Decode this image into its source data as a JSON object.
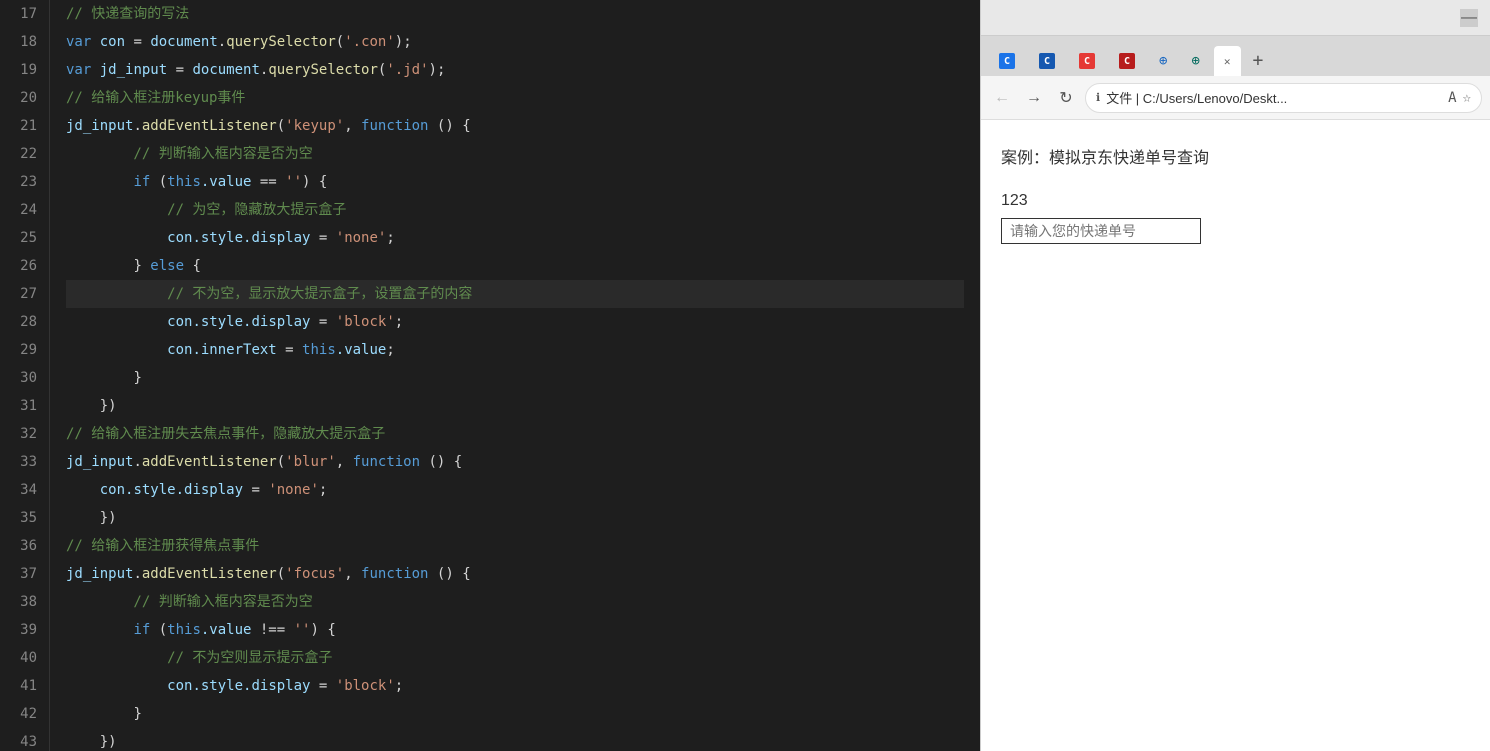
{
  "editor": {
    "lines": [
      {
        "num": 17,
        "tokens": [
          {
            "t": "comment",
            "c": "comment",
            "v": "// 快递查询的写法"
          }
        ]
      },
      {
        "num": 18,
        "tokens": [
          {
            "t": "kw",
            "c": "kw",
            "v": "var"
          },
          {
            "t": "sp",
            "c": "punc",
            "v": " "
          },
          {
            "t": "varname",
            "c": "varname",
            "v": "con"
          },
          {
            "t": "op",
            "c": "op",
            "v": " = "
          },
          {
            "t": "obj",
            "c": "varname",
            "v": "document"
          },
          {
            "t": "dot",
            "c": "punc",
            "v": "."
          },
          {
            "t": "fn",
            "c": "method",
            "v": "querySelector"
          },
          {
            "t": "p1",
            "c": "punc",
            "v": "("
          },
          {
            "t": "str",
            "c": "str",
            "v": "'.con'"
          },
          {
            "t": "p2",
            "c": "punc",
            "v": ");"
          }
        ]
      },
      {
        "num": 19,
        "tokens": [
          {
            "t": "kw",
            "c": "kw",
            "v": "var"
          },
          {
            "t": "sp",
            "c": "punc",
            "v": " "
          },
          {
            "t": "varname",
            "c": "varname",
            "v": "jd_input"
          },
          {
            "t": "op",
            "c": "op",
            "v": " = "
          },
          {
            "t": "obj",
            "c": "varname",
            "v": "document"
          },
          {
            "t": "dot",
            "c": "punc",
            "v": "."
          },
          {
            "t": "fn",
            "c": "method",
            "v": "querySelector"
          },
          {
            "t": "p1",
            "c": "punc",
            "v": "("
          },
          {
            "t": "str",
            "c": "str",
            "v": "'.jd'"
          },
          {
            "t": "p2",
            "c": "punc",
            "v": ");"
          }
        ]
      },
      {
        "num": 20,
        "tokens": [
          {
            "t": "comment",
            "c": "comment",
            "v": "// 给输入框注册keyup事件"
          }
        ]
      },
      {
        "num": 21,
        "tokens": [
          {
            "t": "varname",
            "c": "varname",
            "v": "jd_input"
          },
          {
            "t": "dot",
            "c": "punc",
            "v": "."
          },
          {
            "t": "fn",
            "c": "method",
            "v": "addEventListener"
          },
          {
            "t": "p1",
            "c": "punc",
            "v": "("
          },
          {
            "t": "str",
            "c": "str",
            "v": "'keyup'"
          },
          {
            "t": "cm",
            "c": "punc",
            "v": ", "
          },
          {
            "t": "kw",
            "c": "kw",
            "v": "function"
          },
          {
            "t": "sp2",
            "c": "punc",
            "v": " () {"
          }
        ]
      },
      {
        "num": 22,
        "tokens": [
          {
            "t": "comment",
            "c": "comment",
            "v": "        // 判断输入框内容是否为空"
          }
        ]
      },
      {
        "num": 23,
        "tokens": [
          {
            "t": "sp3",
            "c": "punc",
            "v": "        "
          },
          {
            "t": "kw",
            "c": "kw",
            "v": "if"
          },
          {
            "t": "cond",
            "c": "punc",
            "v": " ("
          },
          {
            "t": "this",
            "c": "kw",
            "v": "this"
          },
          {
            "t": "prop",
            "c": "prop",
            "v": ".value"
          },
          {
            "t": "op2",
            "c": "punc",
            "v": " == "
          },
          {
            "t": "str2",
            "c": "str",
            "v": "''"
          },
          {
            "t": "p3",
            "c": "punc",
            "v": ") {"
          }
        ]
      },
      {
        "num": 24,
        "tokens": [
          {
            "t": "comment",
            "c": "comment",
            "v": "            // 为空，隐藏放大提示盒子"
          }
        ]
      },
      {
        "num": 25,
        "tokens": [
          {
            "t": "sp4",
            "c": "punc",
            "v": "            "
          },
          {
            "t": "varname2",
            "c": "varname",
            "v": "con"
          },
          {
            "t": "prop2",
            "c": "prop",
            "v": ".style"
          },
          {
            "t": "prop3",
            "c": "prop",
            "v": ".display"
          },
          {
            "t": "eq",
            "c": "punc",
            "v": " = "
          },
          {
            "t": "str3",
            "c": "str",
            "v": "'none'"
          },
          {
            "t": "sc",
            "c": "punc",
            "v": ";"
          }
        ]
      },
      {
        "num": 26,
        "tokens": [
          {
            "t": "sp5",
            "c": "punc",
            "v": "        "
          },
          {
            "t": "rb",
            "c": "punc",
            "v": "} "
          },
          {
            "t": "kw2",
            "c": "kw",
            "v": "else"
          },
          {
            "t": "ob",
            "c": "punc",
            "v": " {"
          }
        ]
      },
      {
        "num": 27,
        "highlighted": true,
        "tokens": [
          {
            "t": "comment",
            "c": "comment",
            "v": "            // 不为空，显示放大提示盒子，设置盒子的内容"
          }
        ]
      },
      {
        "num": 28,
        "tokens": [
          {
            "t": "sp6",
            "c": "punc",
            "v": "            "
          },
          {
            "t": "varname3",
            "c": "varname",
            "v": "con"
          },
          {
            "t": "prop4",
            "c": "prop",
            "v": ".style"
          },
          {
            "t": "prop5",
            "c": "prop",
            "v": ".display"
          },
          {
            "t": "eq2",
            "c": "punc",
            "v": " = "
          },
          {
            "t": "str4",
            "c": "str",
            "v": "'block'"
          },
          {
            "t": "sc2",
            "c": "punc",
            "v": ";"
          }
        ]
      },
      {
        "num": 29,
        "tokens": [
          {
            "t": "sp7",
            "c": "punc",
            "v": "            "
          },
          {
            "t": "varname4",
            "c": "varname",
            "v": "con"
          },
          {
            "t": "prop6",
            "c": "prop",
            "v": ".innerText"
          },
          {
            "t": "eq3",
            "c": "punc",
            "v": " = "
          },
          {
            "t": "this2",
            "c": "kw",
            "v": "this"
          },
          {
            "t": "prop7",
            "c": "prop",
            "v": ".value"
          },
          {
            "t": "sc3",
            "c": "punc",
            "v": ";"
          }
        ]
      },
      {
        "num": 30,
        "tokens": [
          {
            "t": "sp8",
            "c": "punc",
            "v": "        "
          },
          {
            "t": "rb2",
            "c": "punc",
            "v": "}"
          }
        ]
      },
      {
        "num": 31,
        "tokens": [
          {
            "t": "sp9",
            "c": "punc",
            "v": "    "
          },
          {
            "t": "rb3",
            "c": "punc",
            "v": "})"
          }
        ]
      },
      {
        "num": 32,
        "tokens": [
          {
            "t": "comment",
            "c": "comment",
            "v": "// 给输入框注册失去焦点事件，隐藏放大提示盒子"
          }
        ]
      },
      {
        "num": 33,
        "tokens": [
          {
            "t": "varname5",
            "c": "varname",
            "v": "jd_input"
          },
          {
            "t": "dot2",
            "c": "punc",
            "v": "."
          },
          {
            "t": "fn2",
            "c": "method",
            "v": "addEventListener"
          },
          {
            "t": "p4",
            "c": "punc",
            "v": "("
          },
          {
            "t": "str5",
            "c": "str",
            "v": "'blur'"
          },
          {
            "t": "cm2",
            "c": "punc",
            "v": ", "
          },
          {
            "t": "kw3",
            "c": "kw",
            "v": "function"
          },
          {
            "t": "sp10",
            "c": "punc",
            "v": " () {"
          }
        ]
      },
      {
        "num": 34,
        "tokens": [
          {
            "t": "sp11",
            "c": "punc",
            "v": "    "
          },
          {
            "t": "varname6",
            "c": "varname",
            "v": "con"
          },
          {
            "t": "prop8",
            "c": "prop",
            "v": ".style"
          },
          {
            "t": "prop9",
            "c": "prop",
            "v": ".display"
          },
          {
            "t": "eq4",
            "c": "punc",
            "v": " = "
          },
          {
            "t": "str6",
            "c": "str",
            "v": "'none'"
          },
          {
            "t": "sc4",
            "c": "punc",
            "v": ";"
          }
        ]
      },
      {
        "num": 35,
        "tokens": [
          {
            "t": "sp12",
            "c": "punc",
            "v": "    "
          },
          {
            "t": "rb4",
            "c": "punc",
            "v": "})"
          }
        ]
      },
      {
        "num": 36,
        "tokens": [
          {
            "t": "comment",
            "c": "comment",
            "v": "// 给输入框注册获得焦点事件"
          }
        ]
      },
      {
        "num": 37,
        "tokens": [
          {
            "t": "varname7",
            "c": "varname",
            "v": "jd_input"
          },
          {
            "t": "dot3",
            "c": "punc",
            "v": "."
          },
          {
            "t": "fn3",
            "c": "method",
            "v": "addEventListener"
          },
          {
            "t": "p5",
            "c": "punc",
            "v": "("
          },
          {
            "t": "str7",
            "c": "str",
            "v": "'focus'"
          },
          {
            "t": "cm3",
            "c": "punc",
            "v": ", "
          },
          {
            "t": "kw4",
            "c": "kw",
            "v": "function"
          },
          {
            "t": "sp13",
            "c": "punc",
            "v": " () {"
          }
        ]
      },
      {
        "num": 38,
        "tokens": [
          {
            "t": "comment",
            "c": "comment",
            "v": "        // 判断输入框内容是否为空"
          }
        ]
      },
      {
        "num": 39,
        "tokens": [
          {
            "t": "sp14",
            "c": "punc",
            "v": "        "
          },
          {
            "t": "kw5",
            "c": "kw",
            "v": "if"
          },
          {
            "t": "cond2",
            "c": "punc",
            "v": " ("
          },
          {
            "t": "this3",
            "c": "kw",
            "v": "this"
          },
          {
            "t": "prop10",
            "c": "prop",
            "v": ".value"
          },
          {
            "t": "op3",
            "c": "punc",
            "v": " !== "
          },
          {
            "t": "str8",
            "c": "str",
            "v": "''"
          },
          {
            "t": "p6",
            "c": "punc",
            "v": ") {"
          }
        ]
      },
      {
        "num": 40,
        "tokens": [
          {
            "t": "comment",
            "c": "comment",
            "v": "            // 不为空则显示提示盒子"
          }
        ]
      },
      {
        "num": 41,
        "tokens": [
          {
            "t": "sp15",
            "c": "punc",
            "v": "            "
          },
          {
            "t": "varname8",
            "c": "varname",
            "v": "con"
          },
          {
            "t": "prop11",
            "c": "prop",
            "v": ".style"
          },
          {
            "t": "prop12",
            "c": "prop",
            "v": ".display"
          },
          {
            "t": "eq5",
            "c": "punc",
            "v": " = "
          },
          {
            "t": "str9",
            "c": "str",
            "v": "'block'"
          },
          {
            "t": "sc5",
            "c": "punc",
            "v": ";"
          }
        ]
      },
      {
        "num": 42,
        "tokens": [
          {
            "t": "sp16",
            "c": "punc",
            "v": "        "
          },
          {
            "t": "rb5",
            "c": "punc",
            "v": "}"
          }
        ]
      },
      {
        "num": 43,
        "tokens": [
          {
            "t": "sp17",
            "c": "punc",
            "v": "    "
          },
          {
            "t": "rb6",
            "c": "punc",
            "v": "})"
          }
        ]
      }
    ]
  },
  "browser": {
    "minimize_label": "—",
    "tabs": [
      {
        "icon": "C",
        "color": "blue",
        "label": "",
        "active": false
      },
      {
        "icon": "C",
        "color": "darkblue",
        "label": "",
        "active": false
      },
      {
        "icon": "C",
        "color": "red",
        "label": "",
        "active": false
      },
      {
        "icon": "C",
        "color": "darkred",
        "label": "",
        "active": false
      },
      {
        "icon": "⊕",
        "color": "green",
        "label": "",
        "active": false
      },
      {
        "icon": "⊕",
        "color": "teal",
        "label": "",
        "active": false
      },
      {
        "icon": "×",
        "color": "",
        "label": "",
        "active": true,
        "close": true
      }
    ],
    "new_tab_label": "+",
    "nav": {
      "back": "←",
      "forward": "→",
      "refresh": "↻",
      "url_prefix": "文件 | C:/Users/Lenovo/Deskt..."
    },
    "page": {
      "title": "案例：模拟京东快递单号查询",
      "tracking_number": "123",
      "input_placeholder": "请输入您的快递单号"
    }
  }
}
